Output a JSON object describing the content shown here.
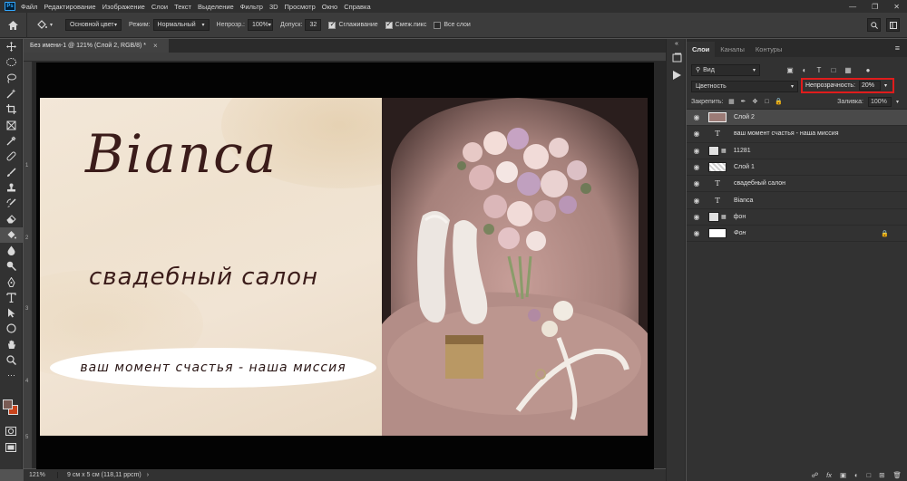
{
  "app": {
    "logo_text": "Ps"
  },
  "menu": [
    "Файл",
    "Редактирование",
    "Изображение",
    "Слои",
    "Текст",
    "Выделение",
    "Фильтр",
    "3D",
    "Просмотр",
    "Окно",
    "Справка"
  ],
  "options": {
    "source_label": "Основной цвет",
    "mode_label": "Режим:",
    "mode_value": "Нормальный",
    "opacity_label": "Непрозр.:",
    "opacity_value": "100%",
    "tolerance_label": "Допуск:",
    "tolerance_value": "32",
    "antialias_label": "Сглаживание",
    "contiguous_label": "Смеж.пикс",
    "all_layers_label": "Все слои"
  },
  "document": {
    "tab_title": "Без имени-1 @ 121% (Слой 2, RGB/8) *",
    "close": "×"
  },
  "ruler_v": [
    "1",
    "2",
    "3",
    "4",
    "5"
  ],
  "artwork": {
    "brand": "Bianca",
    "salon": "свадебный салон",
    "mission": "ваш момент счастья - наша миссия"
  },
  "status": {
    "zoom": "121%",
    "dimensions": "9 см x 5 см (118,11 ppcm)"
  },
  "layers_panel": {
    "tabs": [
      "Слои",
      "Каналы",
      "Контуры"
    ],
    "filter_label": "Вид",
    "blend_mode": "Цветность",
    "opacity_label": "Непрозрачность:",
    "opacity_value": "20%",
    "lock_label": "Закрепить:",
    "fill_label": "Заливка:",
    "fill_value": "100%",
    "layers": [
      {
        "name": "Слой 2",
        "kind": "pink"
      },
      {
        "name": "ваш момент счастья - наша миссия",
        "kind": "text"
      },
      {
        "name": "11281",
        "kind": "smart"
      },
      {
        "name": "Слой 1",
        "kind": "checker"
      },
      {
        "name": "свадебный салон",
        "kind": "text"
      },
      {
        "name": "Bianca",
        "kind": "text"
      },
      {
        "name": "фон",
        "kind": "smart"
      },
      {
        "name": "Фон",
        "kind": "white"
      }
    ]
  },
  "colors": {
    "foreground": "#7a5b54",
    "background": "#c9441c",
    "highlight": "#e01c1c"
  }
}
